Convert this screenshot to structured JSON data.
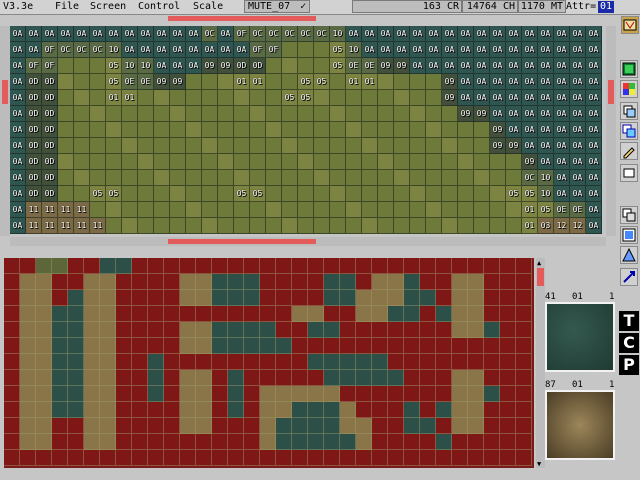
{
  "menubar": {
    "version": "V3.3e",
    "menus": [
      "File",
      "Screen",
      "Control",
      "Scale"
    ],
    "map_name": "MUTE_07",
    "map_check": "✓",
    "status": {
      "cr": "163 CR",
      "ch": "14764 CH",
      "mt": "1170 MT",
      "attr_label": "Attr=",
      "attr_value": "01"
    }
  },
  "upper_map": {
    "rows": [
      [
        "0A",
        "0A",
        "0A",
        "0A",
        "0A",
        "0A",
        "0A",
        "0A",
        "0A",
        "0A",
        "0A",
        "0A",
        "0C",
        "0A",
        "0F",
        "0C",
        "0C",
        "0C",
        "0C",
        "0C",
        "10",
        "0A",
        "0A",
        "0A",
        "0A",
        "0A",
        "0A",
        "0A",
        "0A",
        "0A",
        "0A",
        "0A",
        "0A",
        "0A",
        "0A",
        "0A",
        "0A"
      ],
      [
        "0A",
        "0A",
        "0F",
        "0C",
        "0C",
        "0C",
        "10",
        "0A",
        "0A",
        "0A",
        "0A",
        "0A",
        "0A",
        "0A",
        "0A",
        "0F",
        "0F",
        "",
        "",
        "",
        "05",
        "10",
        "0A",
        "0A",
        "0A",
        "0A",
        "0A",
        "0A",
        "0A",
        "0A",
        "0A",
        "0A",
        "0A",
        "0A",
        "0A",
        "0A",
        "0A"
      ],
      [
        "0A",
        "0F",
        "0F",
        "",
        "",
        "",
        "05",
        "10",
        "10",
        "0A",
        "0A",
        "0A",
        "09",
        "09",
        "0D",
        "0D",
        "",
        "",
        "",
        "",
        "05",
        "0E",
        "0E",
        "09",
        "09",
        "0A",
        "0A",
        "0A",
        "0A",
        "0A",
        "0A",
        "0A",
        "0A",
        "0A",
        "0A",
        "0A",
        "0A"
      ],
      [
        "0A",
        "0D",
        "0D",
        "",
        "",
        "",
        "05",
        "0E",
        "0E",
        "09",
        "09",
        "",
        "",
        "",
        "01",
        "01",
        "",
        "",
        "05",
        "05",
        "",
        "01",
        "01",
        "",
        "",
        "",
        "",
        "09",
        "0A",
        "0A",
        "0A",
        "0A",
        "0A",
        "0A",
        "0A",
        "0A",
        "0A"
      ],
      [
        "0A",
        "0D",
        "0D",
        "",
        "",
        "",
        "01",
        "01",
        "",
        "",
        "",
        "",
        "",
        "",
        "",
        "",
        "",
        "05",
        "05",
        "",
        "",
        "",
        "",
        "",
        "",
        "",
        "",
        "09",
        "0A",
        "0A",
        "0A",
        "0A",
        "0A",
        "0A",
        "0A",
        "0A",
        "0A"
      ],
      [
        "0A",
        "0D",
        "0D",
        "",
        "",
        "",
        "",
        "",
        "",
        "",
        "",
        "",
        "",
        "",
        "",
        "",
        "",
        "",
        "",
        "",
        "",
        "",
        "",
        "",
        "",
        "",
        "",
        "",
        "09",
        "09",
        "0A",
        "0A",
        "0A",
        "0A",
        "0A",
        "0A",
        "0A"
      ],
      [
        "0A",
        "0D",
        "0D",
        "",
        "",
        "",
        "",
        "",
        "",
        "",
        "",
        "",
        "",
        "",
        "",
        "",
        "",
        "",
        "",
        "",
        "",
        "",
        "",
        "",
        "",
        "",
        "",
        "",
        "",
        "",
        "09",
        "0A",
        "0A",
        "0A",
        "0A",
        "0A",
        "0A"
      ],
      [
        "0A",
        "0D",
        "0D",
        "",
        "",
        "",
        "",
        "",
        "",
        "",
        "",
        "",
        "",
        "",
        "",
        "",
        "",
        "",
        "",
        "",
        "",
        "",
        "",
        "",
        "",
        "",
        "",
        "",
        "",
        "",
        "09",
        "09",
        "0A",
        "0A",
        "0A",
        "0A",
        "0A"
      ],
      [
        "0A",
        "0D",
        "0D",
        "",
        "",
        "",
        "",
        "",
        "",
        "",
        "",
        "",
        "",
        "",
        "",
        "",
        "",
        "",
        "",
        "",
        "",
        "",
        "",
        "",
        "",
        "",
        "",
        "",
        "",
        "",
        "",
        "",
        "09",
        "0A",
        "0A",
        "0A",
        "0A"
      ],
      [
        "0A",
        "0D",
        "0D",
        "",
        "",
        "",
        "",
        "",
        "",
        "",
        "",
        "",
        "",
        "",
        "",
        "",
        "",
        "",
        "",
        "",
        "",
        "",
        "",
        "",
        "",
        "",
        "",
        "",
        "",
        "",
        "",
        "",
        "0C",
        "10",
        "0A",
        "0A",
        "0A"
      ],
      [
        "0A",
        "0D",
        "0D",
        "",
        "",
        "05",
        "05",
        "",
        "",
        "",
        "",
        "",
        "",
        "",
        "05",
        "05",
        "",
        "",
        "",
        "",
        "",
        "",
        "",
        "",
        "",
        "",
        "",
        "",
        "",
        "",
        "",
        "05",
        "05",
        "10",
        "0A",
        "0A",
        "0A"
      ],
      [
        "0A",
        "11",
        "11",
        "11",
        "11",
        "",
        "",
        "",
        "",
        "",
        "",
        "",
        "",
        "",
        "",
        "",
        "",
        "",
        "",
        "",
        "",
        "",
        "",
        "",
        "",
        "",
        "",
        "",
        "",
        "",
        "",
        "",
        "01",
        "05",
        "0E",
        "0E",
        "0A"
      ],
      [
        "0A",
        "11",
        "11",
        "11",
        "11",
        "11",
        "",
        "",
        "",
        "",
        "",
        "",
        "",
        "",
        "",
        "",
        "",
        "",
        "",
        "",
        "",
        "",
        "",
        "",
        "",
        "",
        "",
        "",
        "",
        "",
        "",
        "",
        "01",
        "03",
        "12",
        "12",
        "0A"
      ]
    ]
  },
  "preview_tiles": [
    {
      "id": "41",
      "attr": "01",
      "count": "1"
    },
    {
      "id": "87",
      "attr": "01",
      "count": "1"
    }
  ],
  "tool_letters": [
    "T",
    "C",
    "P"
  ],
  "icons": [
    "map-icon",
    "palette-icon",
    "grid-icon",
    "layers-icon",
    "copy-icon",
    "pen-icon",
    "square-icon",
    "window-icon",
    "select-icon",
    "shape-icon",
    "transform-icon",
    "export-icon"
  ],
  "colors": {
    "scroll_accent": "#e35b5b",
    "blocked_tile": "#7f1717",
    "background": "#c6c6c6"
  }
}
